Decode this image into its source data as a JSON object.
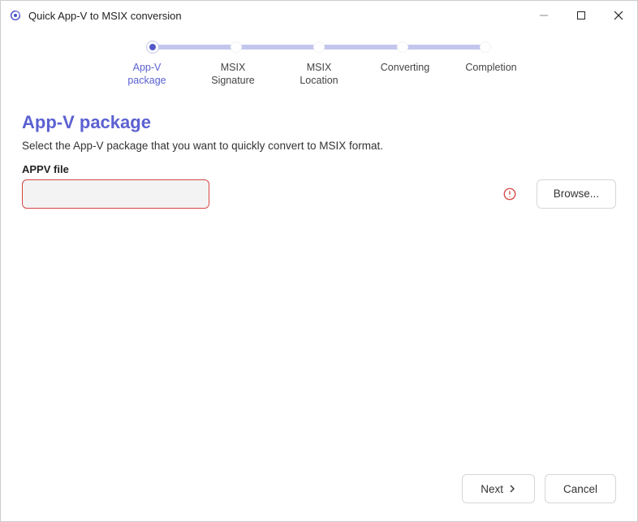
{
  "window": {
    "title": "Quick App-V to MSIX conversion"
  },
  "stepper": {
    "steps": [
      {
        "label": "App-V package",
        "active": true
      },
      {
        "label": "MSIX Signature",
        "active": false
      },
      {
        "label": "MSIX Location",
        "active": false
      },
      {
        "label": "Converting",
        "active": false
      },
      {
        "label": "Completion",
        "active": false
      }
    ]
  },
  "page": {
    "title": "App-V package",
    "description": "Select the App-V package that you want to quickly convert to MSIX format.",
    "field_label": "APPV file",
    "file_value": "",
    "browse_label": "Browse..."
  },
  "footer": {
    "next_label": "Next",
    "cancel_label": "Cancel"
  }
}
